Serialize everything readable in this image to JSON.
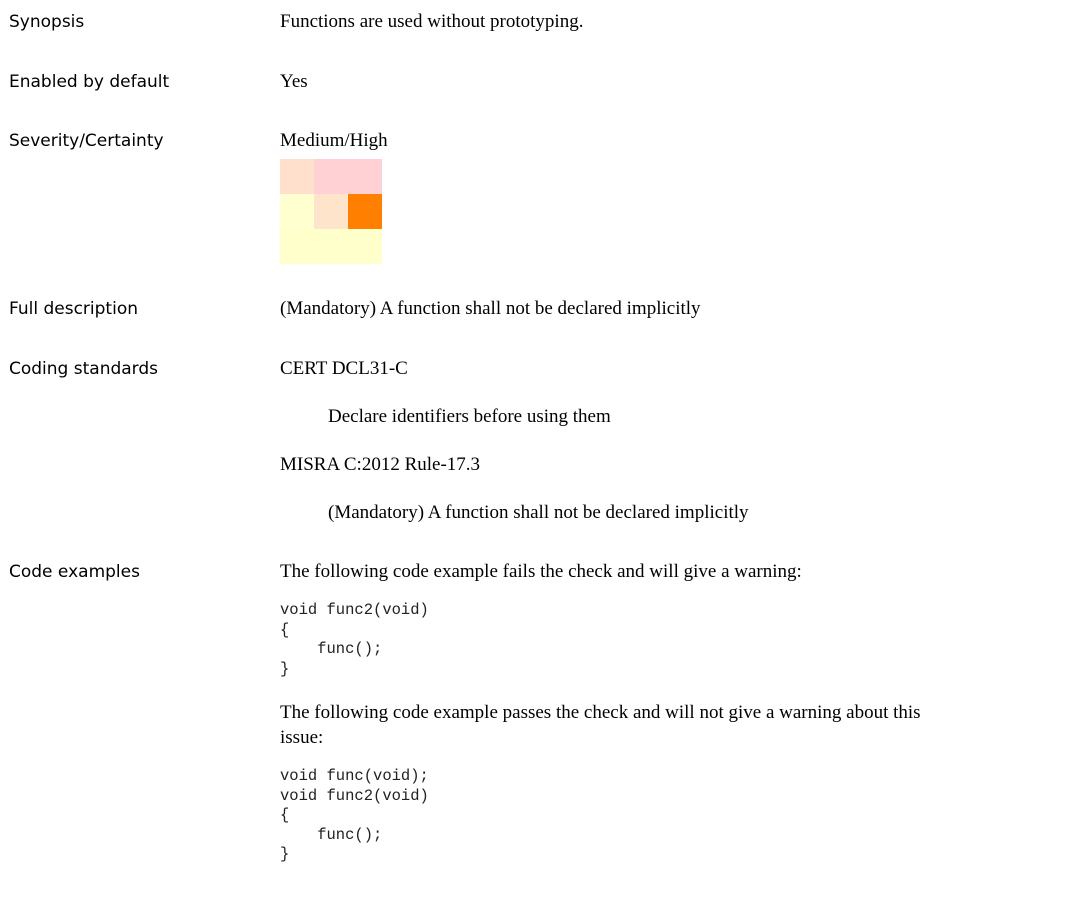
{
  "synopsis": {
    "label": "Synopsis",
    "value": "Functions are used without prototyping."
  },
  "enabled": {
    "label": "Enabled by default",
    "value": "Yes"
  },
  "severity": {
    "label": "Severity/Certainty",
    "value": "Medium/High",
    "matrix_colors": [
      [
        "#ffe0cc",
        "#ffd0d4",
        "#ffd0d4"
      ],
      [
        "#ffffd0",
        "#ffe4cc",
        "#ff8000"
      ],
      [
        "#ffffcc",
        "#ffffcc",
        "#ffffcc"
      ]
    ]
  },
  "full_description": {
    "label": "Full description",
    "value": "(Mandatory) A function shall not be declared implicitly"
  },
  "coding_standards": {
    "label": "Coding standards",
    "items": [
      {
        "name": "CERT DCL31-C",
        "description": "Declare identifiers before using them"
      },
      {
        "name": "MISRA C:2012 Rule-17.3",
        "description": "(Mandatory) A function shall not be declared implicitly"
      }
    ]
  },
  "code_examples": {
    "label": "Code examples",
    "fail_text": "The following code example fails the check and will give a warning:",
    "fail_code": "void func2(void)\n{\n    func();\n}",
    "pass_text_line1": "The following code example passes the check and will not give a warning about this",
    "pass_text_line2": "issue:",
    "pass_code": "void func(void);\nvoid func2(void)\n{\n    func();\n}"
  }
}
